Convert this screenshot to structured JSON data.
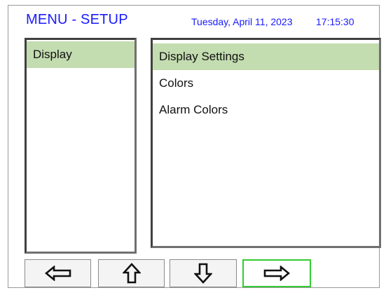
{
  "header": {
    "title": "MENU - SETUP",
    "date": "Tuesday, April 11, 2023",
    "time": "17:15:30",
    "accent_color": "#1a1aff"
  },
  "left_menu": {
    "items": [
      {
        "label": "Display",
        "selected": true
      }
    ]
  },
  "right_menu": {
    "items": [
      {
        "label": "Display Settings",
        "selected": true
      },
      {
        "label": "Colors",
        "selected": false
      },
      {
        "label": "Alarm Colors",
        "selected": false
      }
    ]
  },
  "selection_color": "#c3dcb0",
  "nav_buttons": [
    {
      "icon": "arrow-left-icon",
      "active": false
    },
    {
      "icon": "arrow-up-icon",
      "active": false
    },
    {
      "icon": "arrow-down-icon",
      "active": false
    },
    {
      "icon": "arrow-right-icon",
      "active": true
    }
  ],
  "active_button_color": "#33cc33"
}
